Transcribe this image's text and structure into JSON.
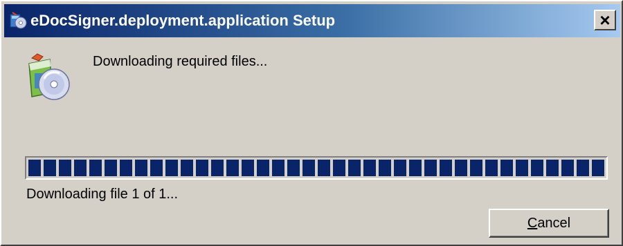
{
  "window": {
    "title": "eDocSigner.deployment.application Setup",
    "title_icon": "setup-package-icon",
    "close_glyph": "×"
  },
  "main": {
    "icon": "software-install-cd-icon",
    "status": "Downloading required files...",
    "progress_fraction": 1.0,
    "file_status": "Downloading file 1 of 1..."
  },
  "buttons": {
    "cancel_accel": "C",
    "cancel_rest": "ancel"
  },
  "colors": {
    "titlebar_start": "#0a246a",
    "titlebar_end": "#a6caf0",
    "progress_block": "#0a246a",
    "face": "#d4d0c8"
  }
}
